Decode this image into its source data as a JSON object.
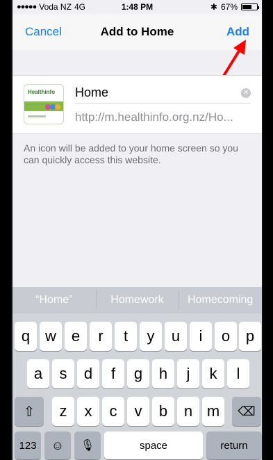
{
  "status_bar": {
    "carrier": "Voda NZ",
    "network": "4G",
    "time": "1:48 PM",
    "battery": "67%",
    "battery_level": 0.67
  },
  "nav": {
    "cancel": "Cancel",
    "title": "Add to Home",
    "add": "Add"
  },
  "bookmark": {
    "name": "Home",
    "url": "http://m.healthinfo.org.nz/Ho...",
    "thumb_logo": "Healthinfo"
  },
  "info_text": "An icon will be added to your home screen so you can quickly access this website.",
  "keyboard": {
    "suggestions": [
      "“Home”",
      "Homework",
      "Homecoming"
    ],
    "row1": [
      "q",
      "w",
      "e",
      "r",
      "t",
      "y",
      "u",
      "i",
      "o",
      "p"
    ],
    "row2": [
      "a",
      "s",
      "d",
      "f",
      "g",
      "h",
      "j",
      "k",
      "l"
    ],
    "row3": [
      "z",
      "x",
      "c",
      "v",
      "b",
      "n",
      "m"
    ],
    "numbers": "123",
    "space": "space",
    "return": "return"
  },
  "colors": {
    "accent": "#147efb",
    "annotation": "#ff0000"
  }
}
